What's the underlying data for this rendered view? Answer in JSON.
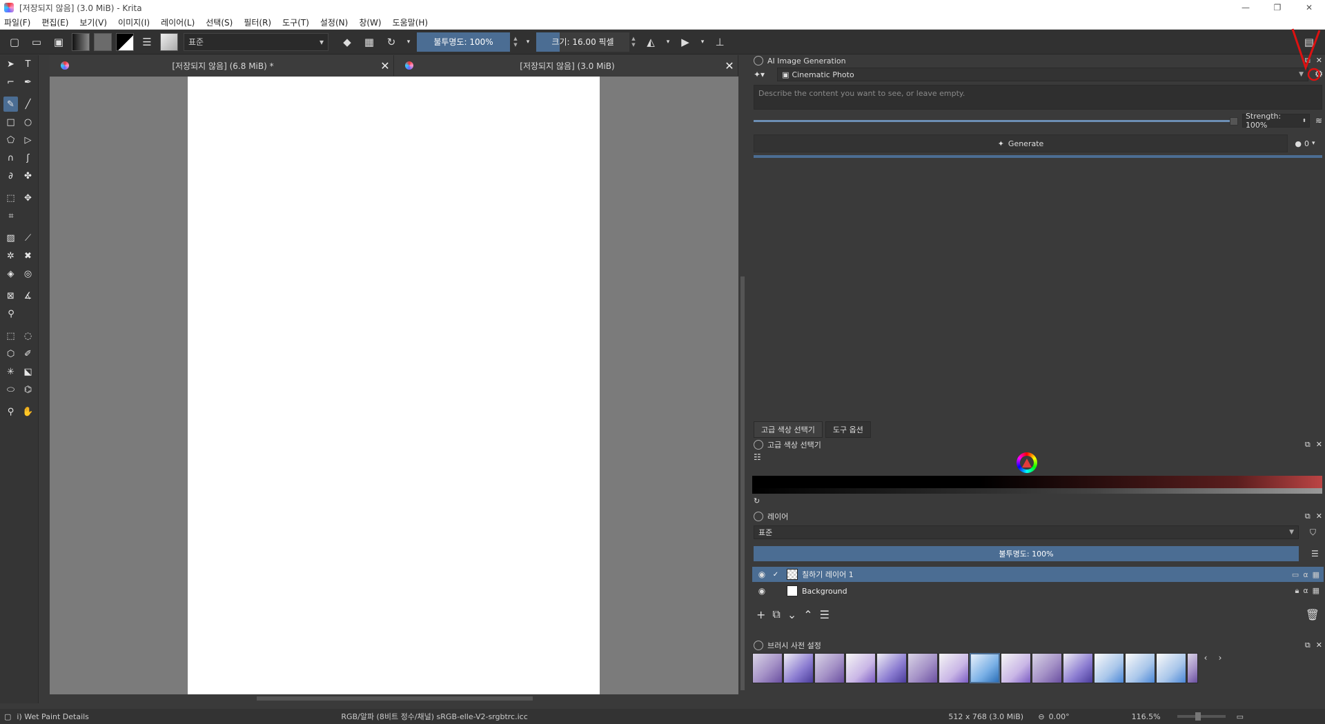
{
  "window": {
    "title": "[저장되지 않음]  (3.0 MiB)  - Krita",
    "controls": [
      "—",
      "❐",
      "✕"
    ]
  },
  "menubar": {
    "items": [
      "파일(F)",
      "편집(E)",
      "보기(V)",
      "이미지(I)",
      "레이어(L)",
      "선택(S)",
      "필터(R)",
      "도구(T)",
      "설정(N)",
      "창(W)",
      "도움말(H)"
    ]
  },
  "toolbar": {
    "preset_name": "표준",
    "opacity_label": "불투명도: 100%",
    "size_label": "크기: 16.00 픽셀"
  },
  "doc_tabs": [
    {
      "label": "[저장되지 않음]  (6.8 MiB) *"
    },
    {
      "label": "[저장되지 않음]  (3.0 MiB)"
    }
  ],
  "ai_panel": {
    "title": "AI Image Generation",
    "style": "Cinematic Photo",
    "prompt_placeholder": "Describe the content you want to see, or leave empty.",
    "strength_label": "Strength: 100%",
    "strength_value": 1.0,
    "generate_label": "Generate",
    "count": "0"
  },
  "dock_tabs": [
    "고급 색상 선택기",
    "도구 옵션"
  ],
  "color_panel": {
    "title": "고급 색상 선택기"
  },
  "layers_panel": {
    "title": "레이어",
    "blend_mode": "표준",
    "opacity_label": "불투명도:  100%",
    "layers": [
      {
        "name": "칠하기 레이어 1",
        "selected": true
      },
      {
        "name": "Background",
        "selected": false
      }
    ]
  },
  "brush_panel": {
    "title": "브러시 사전 설정"
  },
  "statusbar": {
    "tool_text": "i) Wet Paint Details",
    "color_profile": "RGB/알파 (8비트 정수/채널)  sRGB-elle-V2-srgbtrc.icc",
    "dimensions": "512 x 768 (3.0 MiB)",
    "rotation": "0.00°",
    "zoom": "116.5%"
  },
  "colors": {
    "accent": "#4b6d93",
    "canvas_bg": "#7b7b7b",
    "panel_bg": "#3a3a3a"
  }
}
